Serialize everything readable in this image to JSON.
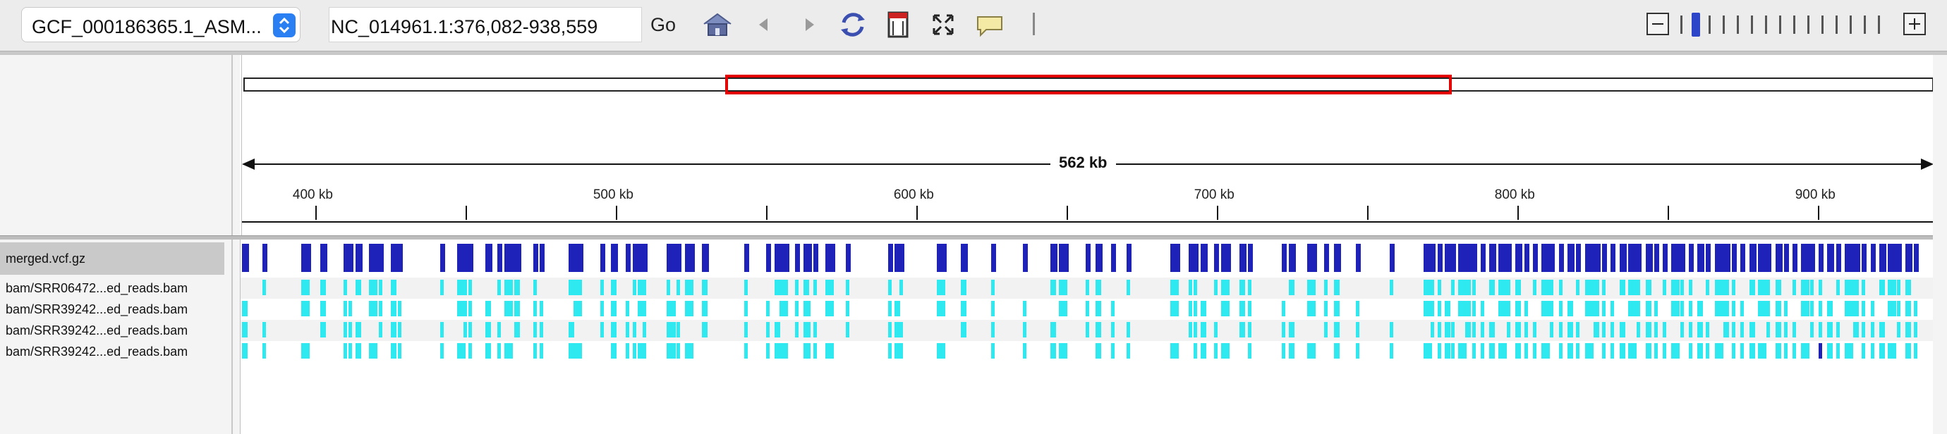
{
  "toolbar": {
    "genome": "GCF_000186365.1_ASM...",
    "locus": "NC_014961.1:376,082-938,559",
    "go_label": "Go",
    "icons": [
      "home-icon",
      "back-icon",
      "forward-icon",
      "refresh-icon",
      "ruler-icon",
      "fit-icon",
      "popup-icon"
    ],
    "zoom_level": 1,
    "zoom_ticks": 15
  },
  "ruler": {
    "span_label": "562 kb",
    "view_start_bp": 376082,
    "view_end_bp": 938559,
    "tick_labels": [
      {
        "bp": 400000,
        "label": "400 kb"
      },
      {
        "bp": 500000,
        "label": "500 kb"
      },
      {
        "bp": 600000,
        "label": "600 kb"
      },
      {
        "bp": 700000,
        "label": "700 kb"
      },
      {
        "bp": 800000,
        "label": "800 kb"
      },
      {
        "bp": 900000,
        "label": "900 kb"
      }
    ],
    "minor_ticks_bp": [
      450000,
      550000,
      650000,
      750000,
      850000
    ],
    "region_fraction": [
      0.285,
      0.715
    ]
  },
  "tracks": {
    "vcf": {
      "name": "merged.vcf.gz"
    },
    "bams": [
      {
        "name": "bam/SRR06472...ed_reads.bam"
      },
      {
        "name": "bam/SRR39242...ed_reads.bam"
      },
      {
        "name": "bam/SRR39242...ed_reads.bam"
      },
      {
        "name": "bam/SRR39242...ed_reads.bam"
      }
    ]
  },
  "variant_positions": [
    0.001,
    0.013,
    0.036,
    0.047,
    0.061,
    0.064,
    0.068,
    0.076,
    0.082,
    0.089,
    0.093,
    0.118,
    0.128,
    0.132,
    0.135,
    0.145,
    0.152,
    0.156,
    0.162,
    0.173,
    0.177,
    0.194,
    0.197,
    0.213,
    0.219,
    0.228,
    0.232,
    0.235,
    0.238,
    0.252,
    0.254,
    0.258,
    0.263,
    0.273,
    0.298,
    0.311,
    0.316,
    0.319,
    0.328,
    0.333,
    0.335,
    0.339,
    0.346,
    0.358,
    0.383,
    0.387,
    0.39,
    0.412,
    0.426,
    0.444,
    0.463,
    0.479,
    0.484,
    0.5,
    0.506,
    0.515,
    0.524,
    0.55,
    0.561,
    0.564,
    0.568,
    0.576,
    0.58,
    0.591,
    0.596,
    0.616,
    0.62,
    0.631,
    0.641,
    0.647,
    0.66,
    0.68,
    0.7,
    0.7041,
    0.7082,
    0.7123,
    0.7164,
    0.7205,
    0.7246,
    0.7287,
    0.7338,
    0.7389,
    0.7441,
    0.7492,
    0.7543,
    0.7594,
    0.7646,
    0.7697,
    0.7748,
    0.7799,
    0.7851,
    0.7902,
    0.7953,
    0.8004,
    0.8055,
    0.8107,
    0.8158,
    0.8209,
    0.826,
    0.8312,
    0.8363,
    0.8414,
    0.8465,
    0.8517,
    0.8568,
    0.8619,
    0.867,
    0.8722,
    0.8773,
    0.8824,
    0.8875,
    0.8927,
    0.8978,
    0.9029,
    0.908,
    0.9132,
    0.9183,
    0.9234,
    0.9285,
    0.9337,
    0.9388,
    0.9439,
    0.949,
    0.9541,
    0.9593,
    0.9644,
    0.9695,
    0.9746,
    0.9798,
    0.9849,
    0.99
  ]
}
